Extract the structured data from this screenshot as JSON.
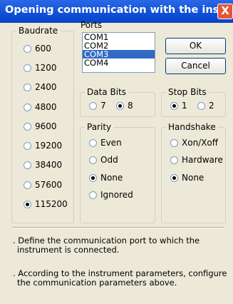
{
  "window": {
    "title": "Opening communication with the ins...",
    "close_glyph": "X"
  },
  "baudrate": {
    "legend": "Baudrate",
    "options": [
      "600",
      "1200",
      "2400",
      "4800",
      "9600",
      "19200",
      "38400",
      "57600",
      "115200"
    ],
    "selected": "115200"
  },
  "ports": {
    "label": "Ports",
    "items": [
      "COM1",
      "COM2",
      "COM3",
      "COM4"
    ],
    "selected": "COM3"
  },
  "buttons": {
    "ok": "OK",
    "cancel": "Cancel"
  },
  "data_bits": {
    "legend": "Data Bits",
    "options": [
      "7",
      "8"
    ],
    "selected": "8"
  },
  "stop_bits": {
    "legend": "Stop Bits",
    "options": [
      "1",
      "2"
    ],
    "selected": "1"
  },
  "parity": {
    "legend": "Parity",
    "options": [
      "Even",
      "Odd",
      "None",
      "Ignored"
    ],
    "selected": "None"
  },
  "handshake": {
    "legend": "Handshake",
    "options": [
      "Xon/Xoff",
      "Hardware",
      "None"
    ],
    "selected": "None"
  },
  "info": {
    "line1a": ". Define the communication port to which the",
    "line1b": "instrument is connected.",
    "line2a": ". According to the instrument parameters, configure",
    "line2b": "the communication parameters above."
  },
  "icons": {
    "scroll_up": "up-arrow-icon",
    "scroll_down": "down-arrow-icon",
    "close": "close-icon"
  },
  "colors": {
    "titlebar": "#0e4fd8",
    "selection": "#316ac5",
    "close": "#e2573a"
  }
}
